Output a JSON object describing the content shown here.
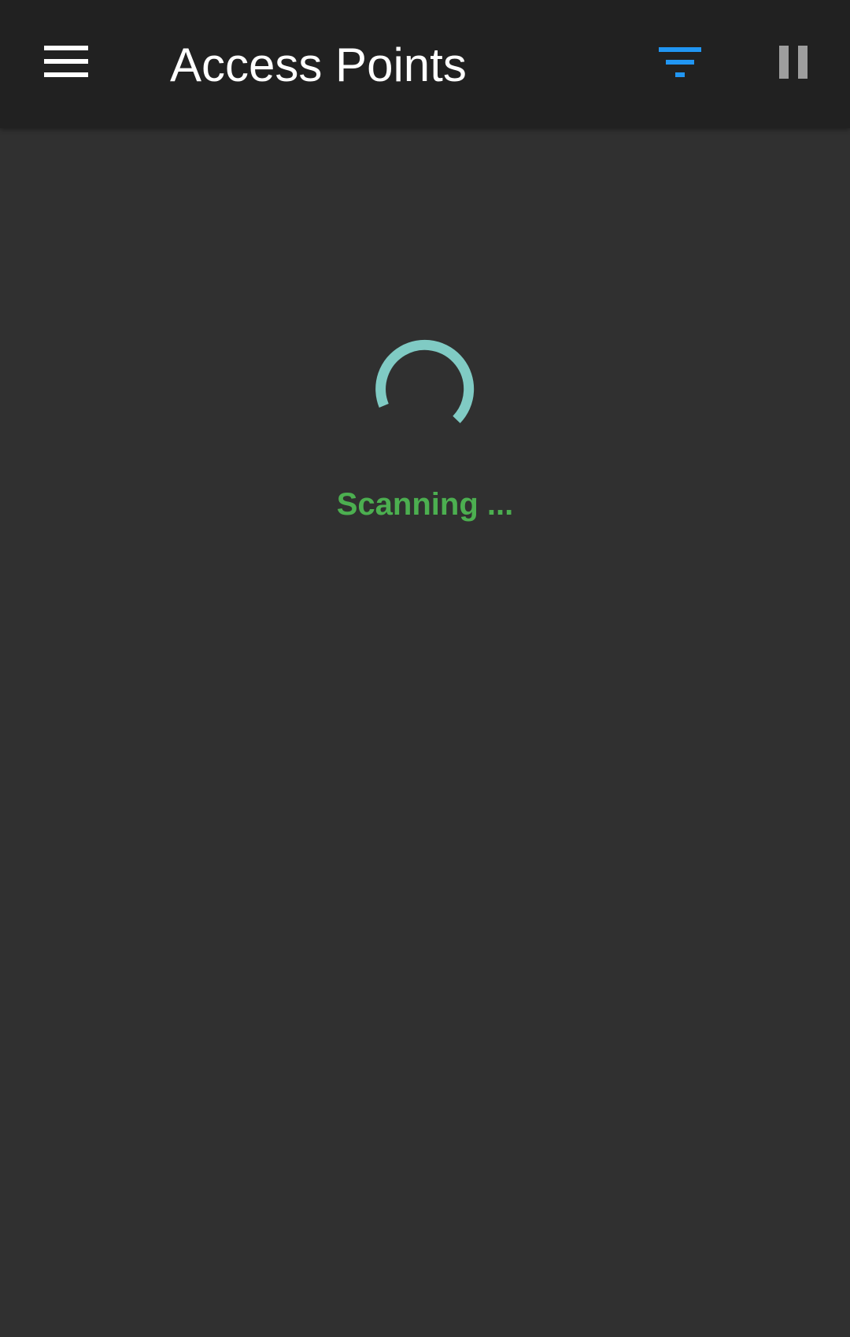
{
  "app_bar": {
    "title": "Access Points",
    "menu_icon": "hamburger-menu-icon",
    "filter_icon": "filter-icon",
    "pause_icon": "pause-icon"
  },
  "content": {
    "spinner_icon": "loading-spinner-icon",
    "status_text": "Scanning ..."
  },
  "colors": {
    "app_bar_background": "#212121",
    "page_background": "#303030",
    "title_text": "#ffffff",
    "filter_accent": "#2196f3",
    "pause_icon": "#9e9e9e",
    "spinner": "#80cbc4",
    "status_text": "#4caf50"
  }
}
